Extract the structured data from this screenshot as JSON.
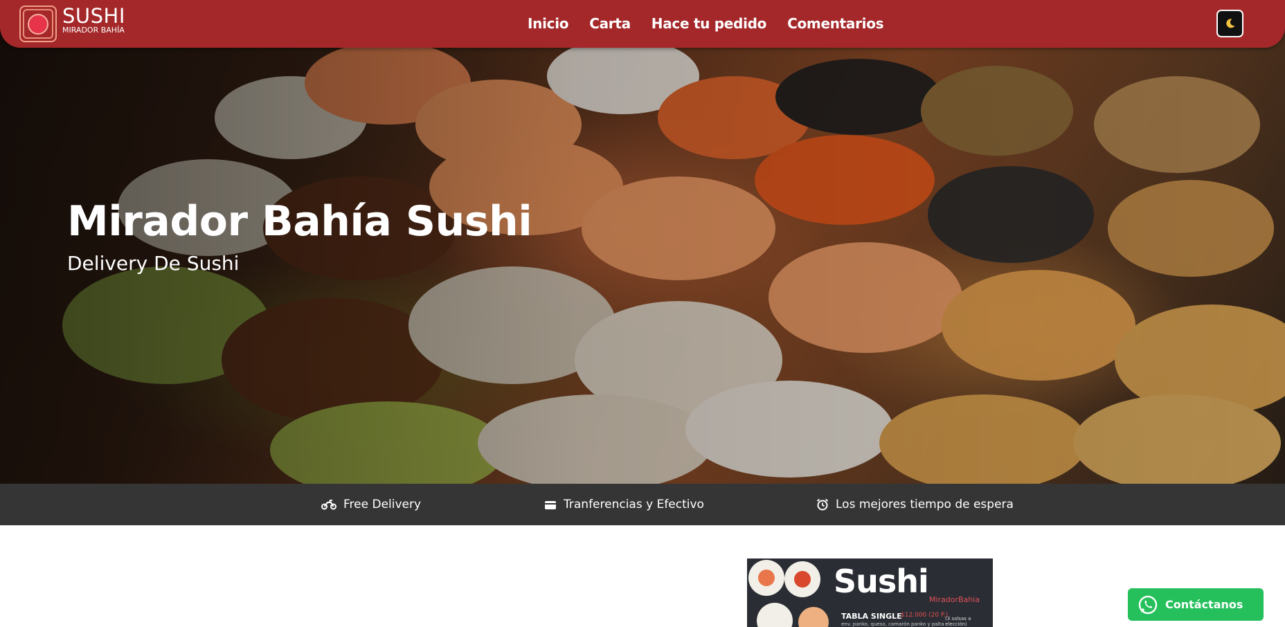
{
  "brand": {
    "name": "SUSHI",
    "subname": "MIRADOR BAHÍA"
  },
  "nav": {
    "links": [
      {
        "label": "Inicio"
      },
      {
        "label": "Carta"
      },
      {
        "label": "Hace tu pedido"
      },
      {
        "label": "Comentarios"
      }
    ],
    "theme_toggle_icon": "moon-icon"
  },
  "hero": {
    "title": "Mirador Bahía Sushi",
    "subtitle": "Delivery De Sushi"
  },
  "features": [
    {
      "icon": "motorcycle-icon",
      "label": "Free Delivery"
    },
    {
      "icon": "wallet-icon",
      "label": "Tranferencias y Efectivo"
    },
    {
      "icon": "alarm-clock-icon",
      "label": "Los mejores tiempo de espera"
    }
  ],
  "menu_preview": {
    "heading": "Sushi",
    "brand": "MiradorBahia",
    "item_name": "TABLA SINGLE",
    "item_price": "$12.000 (20 P.)",
    "item_note": "(3 salsas a elección)",
    "item_desc": "env. panko, queso, camarón panko y palta"
  },
  "contact": {
    "label": "Contáctanos",
    "icon": "whatsapp-icon"
  },
  "colors": {
    "navbar": "#a4282a",
    "feature_bar": "#353535",
    "whatsapp": "#25c05c",
    "logo_accent": "#e8344a"
  }
}
